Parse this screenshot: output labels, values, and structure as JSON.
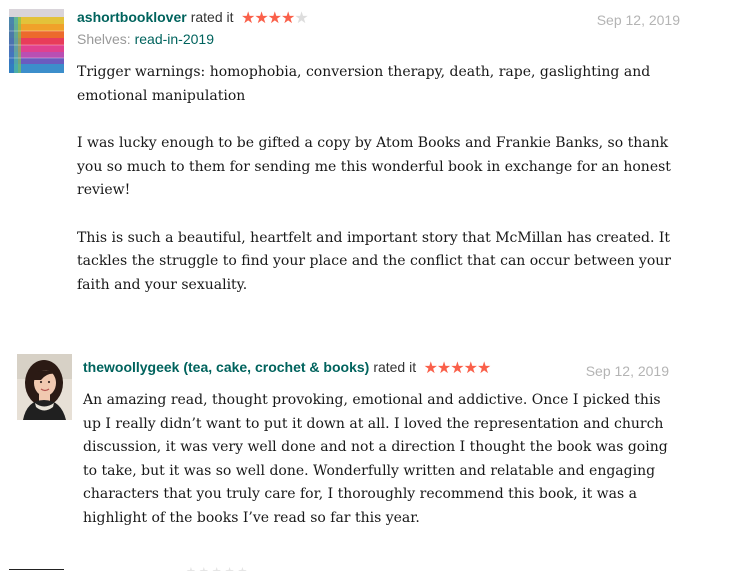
{
  "colors": {
    "username": "#00635d",
    "star_filled": "#fa604a",
    "star_empty": "#dddddd",
    "date": "#b4b4b4",
    "text": "#181818"
  },
  "reviews": [
    {
      "user": "ashortbooklover",
      "rated_text": "rated it",
      "rating": 4,
      "max_rating": 5,
      "shelves_label": "Shelves:",
      "shelf": "read-in-2019",
      "date": "Sep 12, 2019",
      "avatar_icon": "rainbow-bookshelf-avatar",
      "paragraphs": [
        "Trigger warnings: homophobia, conversion therapy, death, rape, gaslighting and emotional manipulation",
        "I was lucky enough to be gifted a copy by Atom Books and Frankie Banks, so thank you so much to them for sending me this wonderful book in exchange for an honest review!",
        "This is such a beautiful, heartfelt and important story that McMillan has created. It tackles the struggle to find your place and the conflict that can occur between your faith and your sexuality."
      ]
    },
    {
      "user": "thewoollygeek (tea, cake, crochet & books)",
      "rated_text": "rated it",
      "rating": 5,
      "max_rating": 5,
      "date": "Sep 12, 2019",
      "avatar_icon": "user-photo-avatar",
      "paragraphs": [
        "An amazing read, thought provoking, emotional and addictive. Once I picked this up I really didn’t want to put it down at all. I loved the representation and church discussion, it was very well done and not a direction I thought the book was going to take, but it was so well done. Wonderfully written and relatable and engaging characters that you truly care for, I thoroughly recommend this book, it was a highlight of the books I’ve read so far this year."
      ]
    }
  ]
}
